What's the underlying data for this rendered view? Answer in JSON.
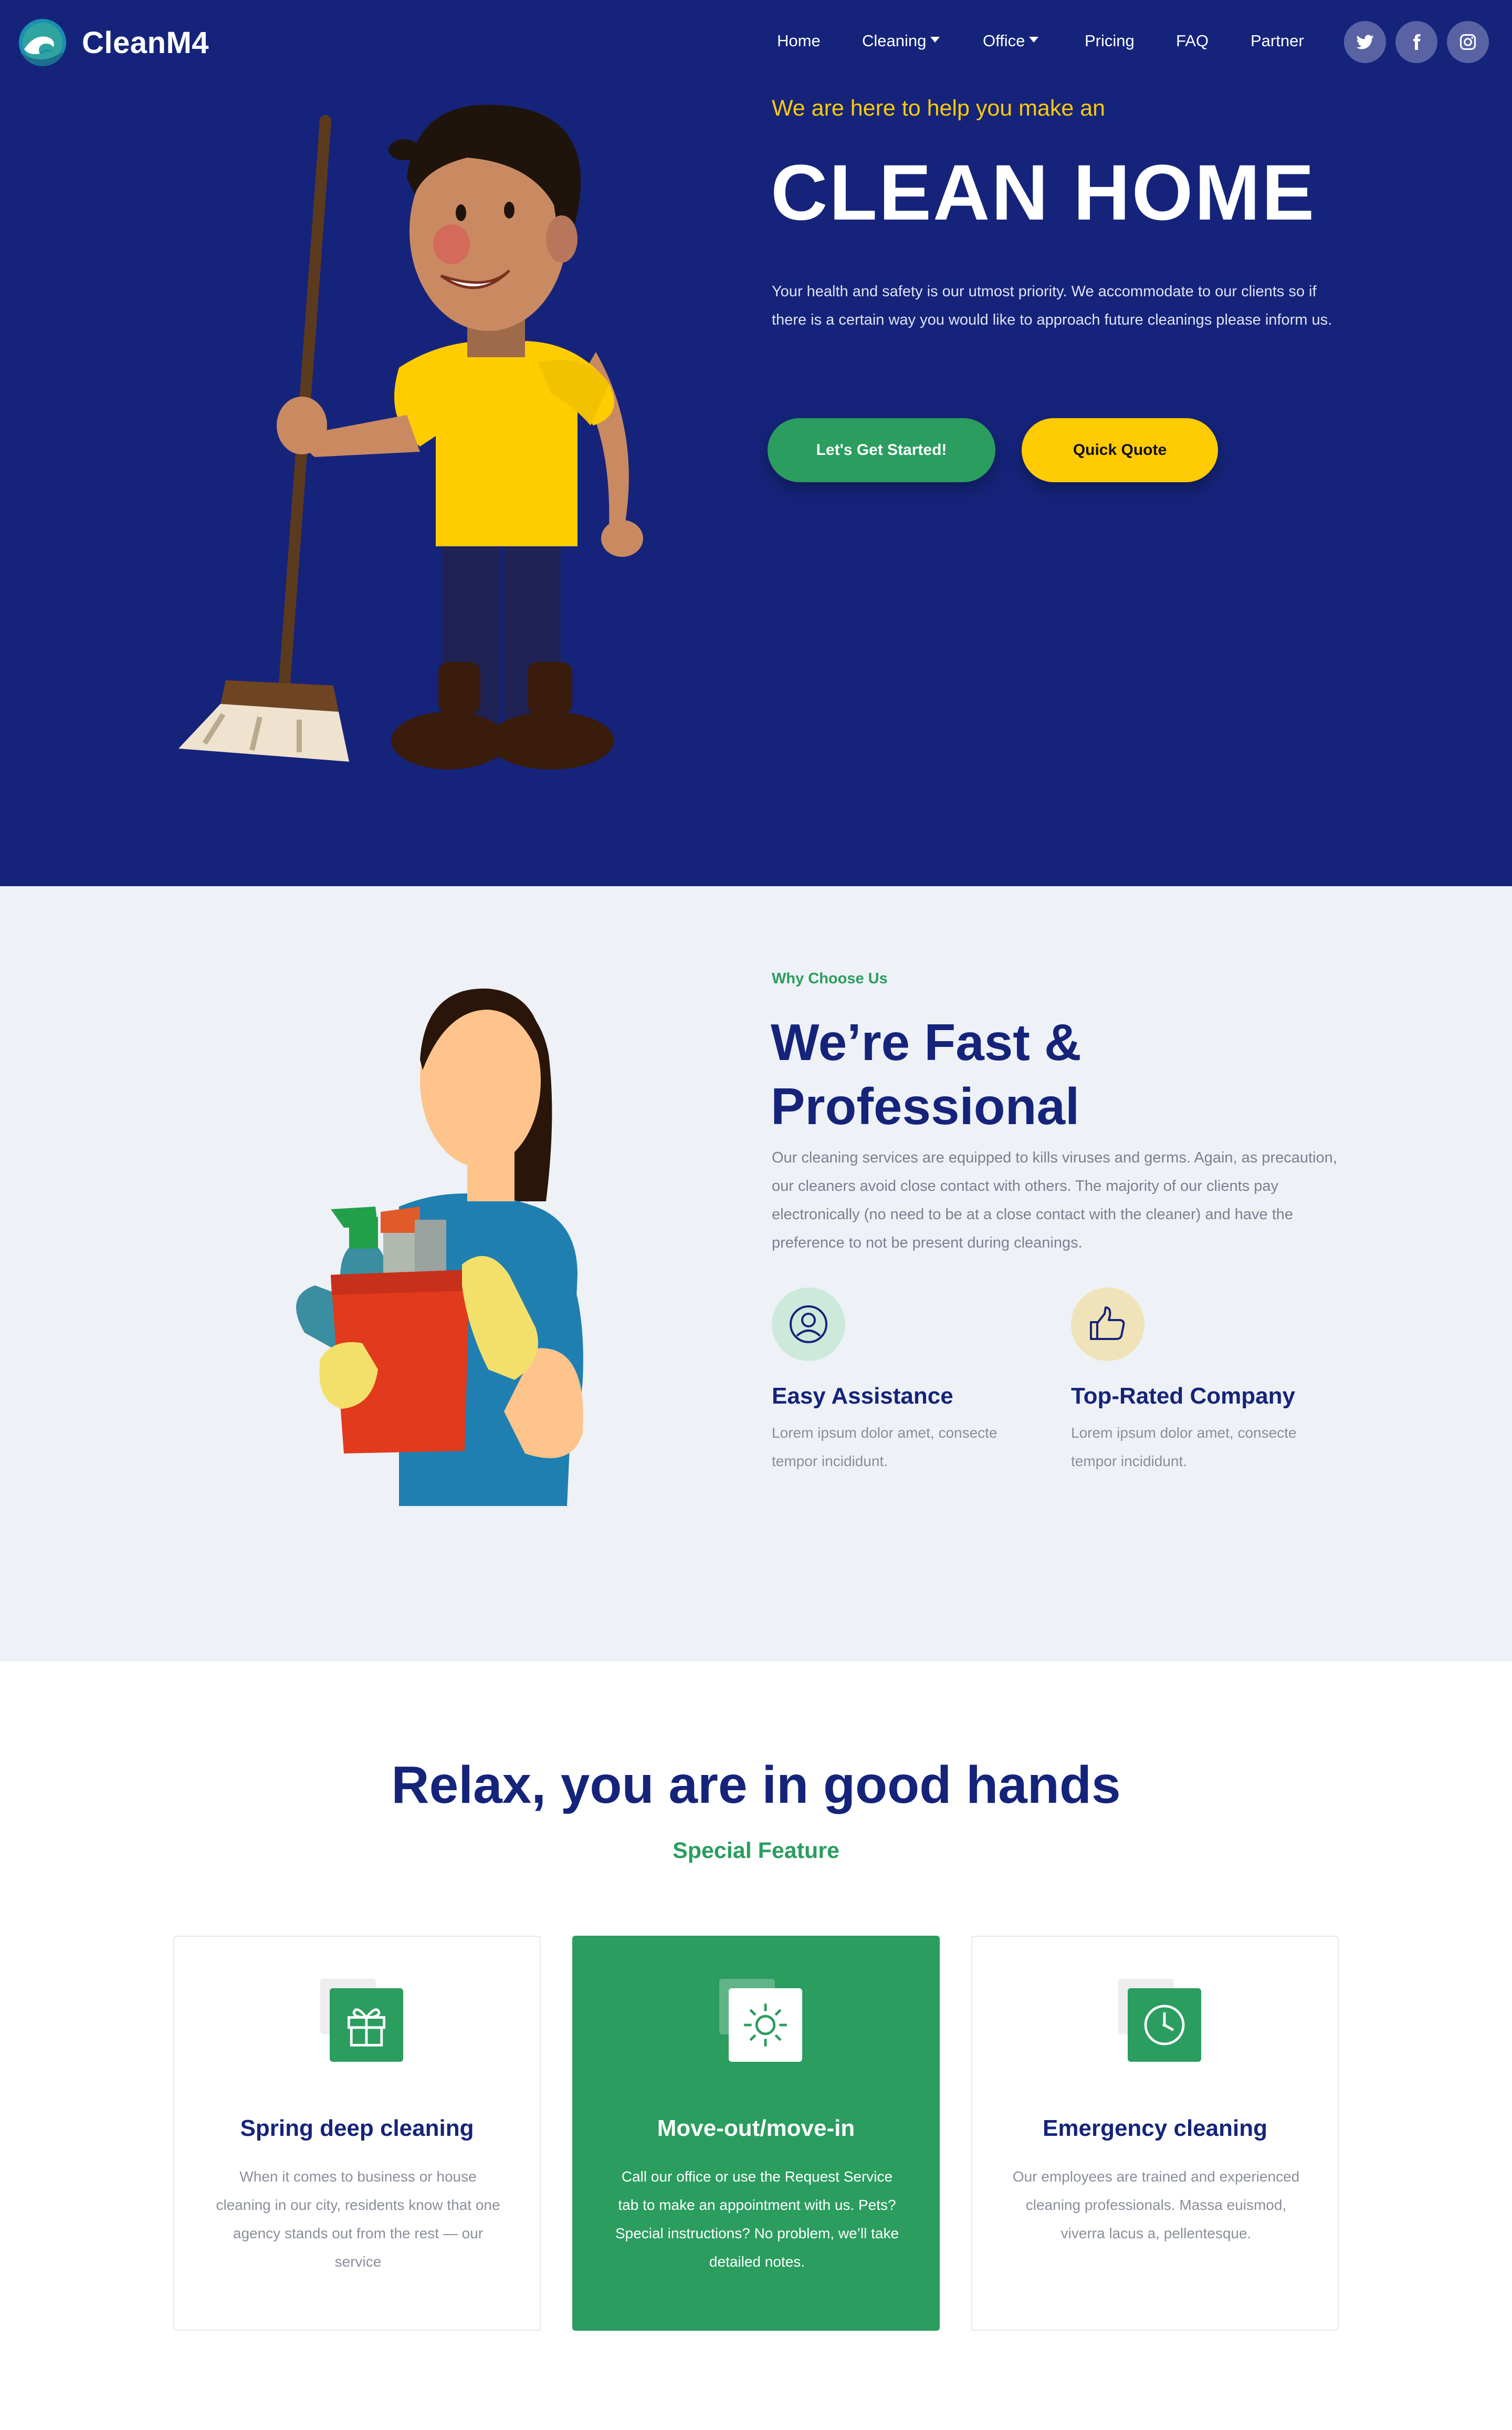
{
  "nav": {
    "brand": "CleanM4",
    "links": [
      {
        "label": "Home"
      },
      {
        "label": "Cleaning",
        "dropdown": true
      },
      {
        "label": "Office",
        "dropdown": true
      },
      {
        "label": "Pricing"
      },
      {
        "label": "FAQ"
      },
      {
        "label": "Partner"
      }
    ],
    "social": [
      "twitter-icon",
      "facebook-icon",
      "instagram-icon"
    ]
  },
  "hero": {
    "kicker": "We are here to help you make an",
    "title": "CLEAN HOME",
    "description": "Your health and safety is our utmost priority. We accommodate to our clients so if there is a certain way you would like to approach future cleanings please inform us.",
    "primary_button": "Let's Get Started!",
    "secondary_button": "Quick Quote"
  },
  "why": {
    "kicker": "Why Choose Us",
    "title": "We’re Fast & Professional",
    "description": "Our cleaning services are equipped to kills viruses and germs. Again, as precaution, our cleaners avoid close contact with others. The majority of our clients pay electronically (no need to be at a close contact with the cleaner) and have the preference to not be present during cleanings.",
    "features": [
      {
        "icon": "user-icon",
        "title": "Easy Assistance",
        "text": "Lorem ipsum dolor amet, consecte tempor incididunt."
      },
      {
        "icon": "thumbs-up-icon",
        "title": "Top-Rated Company",
        "text": "Lorem ipsum dolor amet, consecte tempor incididunt."
      }
    ]
  },
  "services": {
    "title": "Relax, you are in good hands",
    "subtitle": "Special Feature",
    "cards": [
      {
        "icon": "gift-icon",
        "title": "Spring deep cleaning",
        "text": "When it comes to business or house cleaning in our city, residents know that one agency stands out from the rest — our service"
      },
      {
        "icon": "sun-icon",
        "title": "Move-out/move-in",
        "text": "Call our office or use the Request Service tab to make an appointment with us. Pets? Special instructions? No problem, we’ll take detailed notes."
      },
      {
        "icon": "clock-icon",
        "title": "Emergency cleaning",
        "text": "Our employees are trained and experienced cleaning professionals. Massa euismod, viverra lacus a, pellentesque."
      }
    ]
  },
  "colors": {
    "primary_navy": "#15247a",
    "accent_yellow": "#ffcb05",
    "accent_green": "#2a9d5f",
    "light_bg": "#eef1f6"
  }
}
